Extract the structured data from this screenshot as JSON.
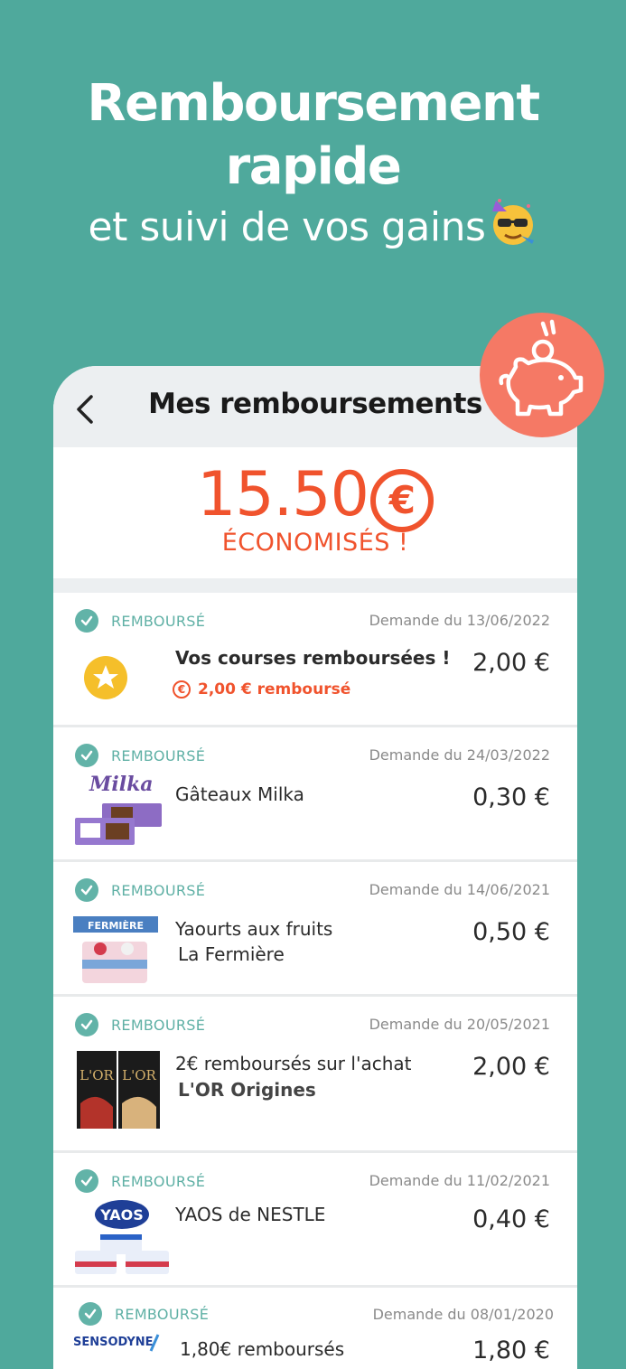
{
  "hero": {
    "title": "Remboursement rapide",
    "subtitle": "et suivi de vos gains"
  },
  "screen": {
    "title": "Mes remboursements",
    "savings_amount": "15.50",
    "savings_currency": "€",
    "savings_label": "ÉCONOMISÉS !"
  },
  "colors": {
    "background": "#4fa99c",
    "accent": "#f0532d",
    "status": "#5fb0a5",
    "piggy_badge": "#f57965"
  },
  "items": [
    {
      "status": "REMBOURSÉ",
      "date": "Demande du 13/06/2022",
      "line1": "Vos courses remboursées !",
      "line2": "2,00 € remboursé",
      "price": "2,00 €",
      "icon": "star-icon"
    },
    {
      "status": "REMBOURSÉ",
      "date": "Demande du 24/03/2022",
      "line1": "Gâteaux Milka",
      "price": "0,30 €",
      "brand": "Milka"
    },
    {
      "status": "REMBOURSÉ",
      "date": "Demande du 14/06/2021",
      "line1": "Yaourts aux fruits",
      "line2": "La Fermière",
      "price": "0,50 €",
      "brand": "FERMIÈRE"
    },
    {
      "status": "REMBOURSÉ",
      "date": "Demande du 20/05/2021",
      "line1": "2€ remboursés sur l'achat",
      "line2": "L'OR Origines",
      "price": "2,00 €",
      "brand": "L'OR"
    },
    {
      "status": "REMBOURSÉ",
      "date": "Demande du 11/02/2021",
      "line1": "YAOS de NESTLE",
      "price": "0,40 €",
      "brand": "YAOS"
    },
    {
      "status": "REMBOURSÉ",
      "date": "Demande du 08/01/2020",
      "line1": "1,80€ remboursés",
      "price": "1,80 €",
      "brand": "SENSODYNE"
    }
  ]
}
